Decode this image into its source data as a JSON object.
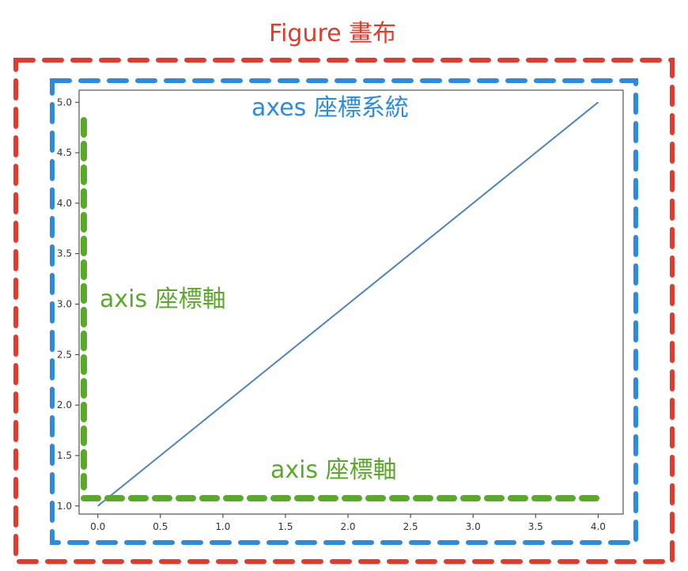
{
  "labels": {
    "figure": "Figure 畫布",
    "axes": "axes 座標系統",
    "axis_y": "axis 座標軸",
    "axis_x": "axis 座標軸"
  },
  "colors": {
    "figure": "#e33a2b",
    "axes": "#2b8be0",
    "axis": "#5aaa2a",
    "line": "#4c84c0"
  },
  "chart_data": {
    "type": "line",
    "x": [
      0.0,
      4.0
    ],
    "series": [
      {
        "values": [
          1.0,
          5.0
        ]
      }
    ],
    "xlim": [
      -0.15,
      4.2
    ],
    "ylim": [
      0.92,
      5.12
    ],
    "xticks": [
      "0.0",
      "0.5",
      "1.0",
      "1.5",
      "2.0",
      "2.5",
      "3.0",
      "3.5",
      "4.0"
    ],
    "yticks": [
      "1.0",
      "1.5",
      "2.0",
      "2.5",
      "3.0",
      "3.5",
      "4.0",
      "4.5",
      "5.0"
    ]
  }
}
